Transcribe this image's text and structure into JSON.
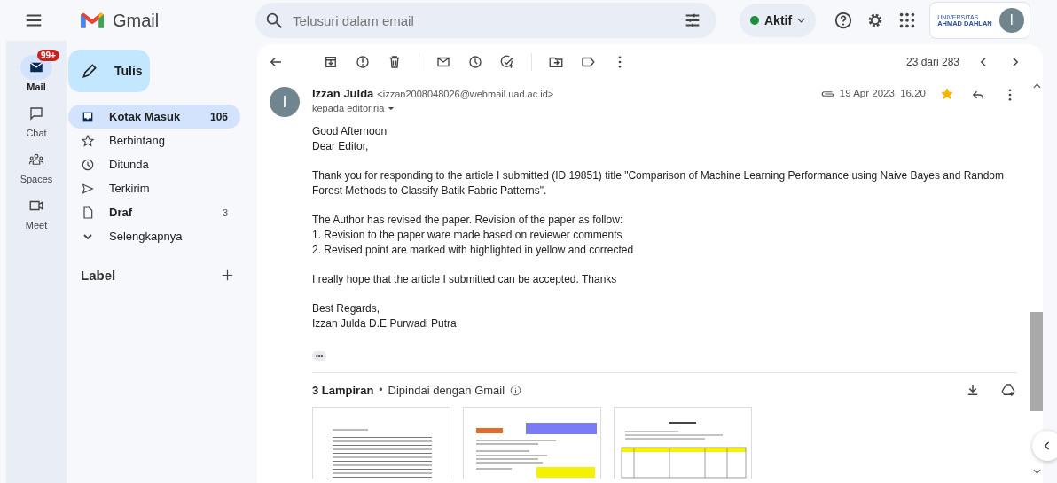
{
  "app": {
    "name": "Gmail"
  },
  "search": {
    "placeholder": "Telusuri dalam email"
  },
  "status": {
    "label": "Aktif",
    "online": true
  },
  "org_logo": {
    "line_1": "UNIVERSITAS",
    "line_2": "AHMAD DAHLAN"
  },
  "account": {
    "initial": "I"
  },
  "rail": [
    {
      "label": "Mail",
      "badge": "99+",
      "selected": true
    },
    {
      "label": "Chat",
      "selected": false
    },
    {
      "label": "Spaces",
      "selected": false
    },
    {
      "label": "Meet",
      "selected": false
    }
  ],
  "compose": {
    "label": "Tulis"
  },
  "folders": [
    {
      "label": "Kotak Masuk",
      "count": "106",
      "selected": true,
      "unread": true
    },
    {
      "label": "Berbintang",
      "selected": false,
      "unread": false
    },
    {
      "label": "Ditunda",
      "selected": false,
      "unread": false
    },
    {
      "label": "Terkirim",
      "selected": false,
      "unread": false
    },
    {
      "label": "Draf",
      "count": "3",
      "selected": false,
      "unread": true
    },
    {
      "label": "Selengkapnya",
      "selected": false,
      "unread": false
    }
  ],
  "labels": {
    "title": "Label"
  },
  "toolbar": {
    "position": "23 dari 283"
  },
  "message": {
    "sender": "Izzan Julda",
    "initial": "I",
    "email": "<izzan2008048026@webmail.uad.ac.id>",
    "recipient": "kepada editor.ria",
    "date": "19 Apr 2023, 16.20",
    "starred": true,
    "body": [
      [
        "Good Afternoon",
        "Dear Editor,"
      ],
      [
        "Thank you for responding to the article I submitted (ID 19851) title \"Comparison of Machine Learning Performance using Naive Bayes and Random Forest Methods to Classify Batik Fabric Patterns\"."
      ],
      [
        "The Author has revised the paper. Revision of the paper as follow:",
        "1. Revision to the paper ware made based on reviewer comments",
        "2. Revised point are marked with highlighted in yellow and corrected"
      ],
      [
        "I really hope that the article I submitted can be accepted. Thanks"
      ],
      [
        "Best Regards,",
        "Izzan Julda D.E Purwadi Putra"
      ]
    ],
    "ellipsis": "•••"
  },
  "attachments": {
    "count_label": "3 Lampiran",
    "separator": "•",
    "scan_note": "Dipindai dengan Gmail",
    "files": [
      {
        "kind": "review"
      },
      {
        "kind": "paper"
      },
      {
        "kind": "table"
      }
    ]
  }
}
